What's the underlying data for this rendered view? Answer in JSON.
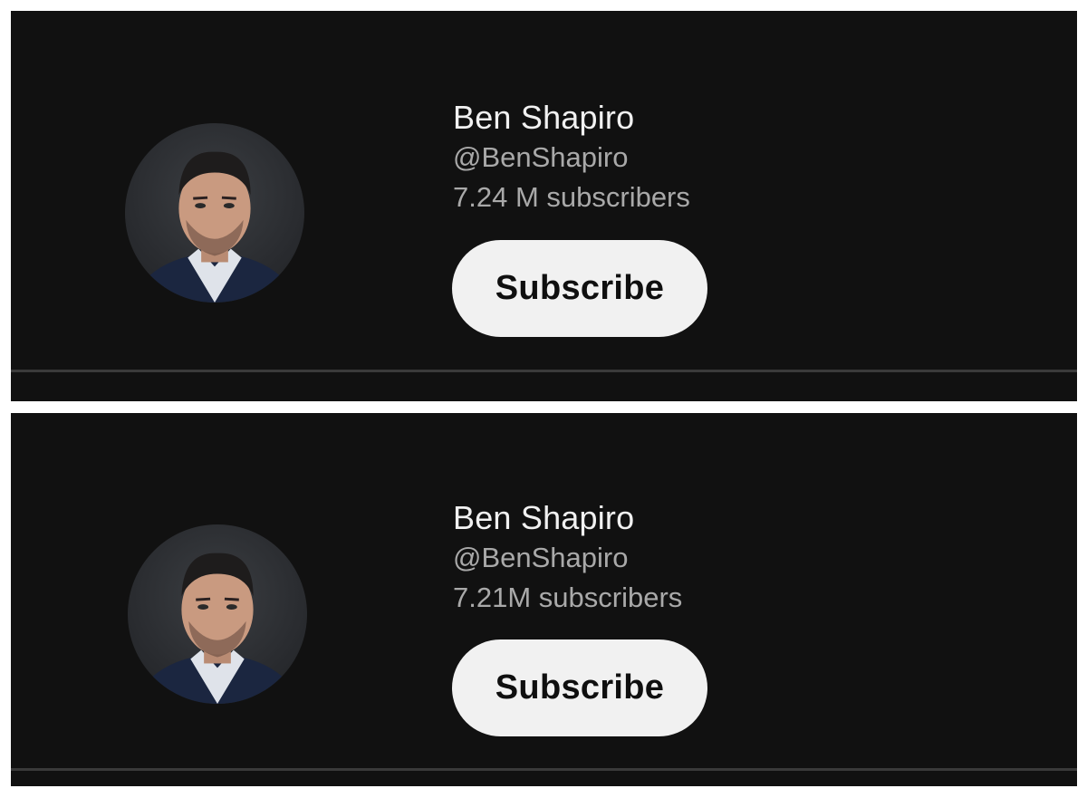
{
  "panels": [
    {
      "channel_name": "Ben Shapiro",
      "handle": "@BenShapiro",
      "subscribers": "7.24 M subscribers",
      "subscribe_label": "Subscribe"
    },
    {
      "channel_name": "Ben Shapiro",
      "handle": "@BenShapiro",
      "subscribers": "7.21M subscribers",
      "subscribe_label": "Subscribe"
    }
  ],
  "colors": {
    "background": "#111111",
    "name_text": "#f1f1f1",
    "secondary_text": "#a9a9a9",
    "button_bg": "#f1f1f1",
    "button_text": "#0f0f0f",
    "divider": "#3a3a3a"
  },
  "icons": [
    "channel-avatar"
  ]
}
